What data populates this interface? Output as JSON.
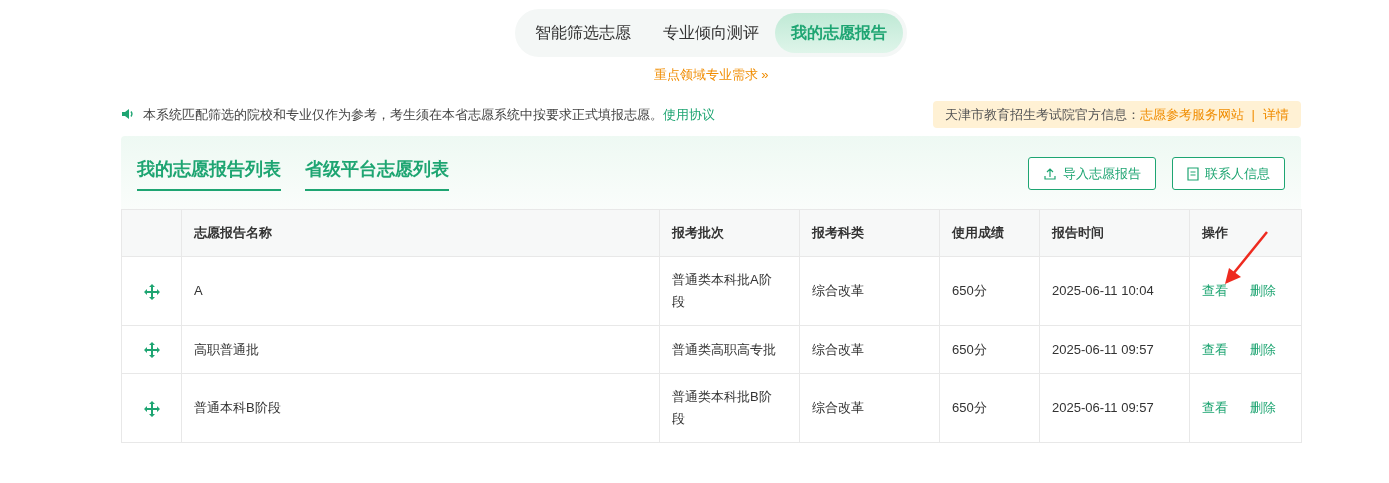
{
  "top_tabs": [
    {
      "label": "智能筛选志愿",
      "selected": false
    },
    {
      "label": "专业倾向测评",
      "selected": false
    },
    {
      "label": "我的志愿报告",
      "selected": true
    }
  ],
  "key_link": {
    "label": "重点领域专业需求",
    "icon": "»"
  },
  "notice": {
    "text": "本系统匹配筛选的院校和专业仅作为参考，考生须在本省志愿系统中按要求正式填报志愿。",
    "link": "使用协议"
  },
  "official_info": {
    "label": "天津市教育招生考试院官方信息：",
    "link": "志愿参考服务网站",
    "separator": "|",
    "detail": "详情"
  },
  "list_tabs": [
    "我的志愿报告列表",
    "省级平台志愿列表"
  ],
  "buttons": [
    {
      "label": "导入志愿报告",
      "kind": "upload"
    },
    {
      "label": "联系人信息",
      "kind": "contact"
    }
  ],
  "table": {
    "columns": [
      "志愿报告名称",
      "报考批次",
      "报考科类",
      "使用成绩",
      "报告时间",
      "操作"
    ],
    "rows": [
      {
        "name": "A",
        "batch": "普通类本科批A阶段",
        "subject": "综合改革",
        "score": "650分",
        "time": "2025-06-11 10:04",
        "actions": [
          "查看",
          "删除"
        ]
      },
      {
        "name": "高职普通批",
        "batch": "普通类高职高专批",
        "subject": "综合改革",
        "score": "650分",
        "time": "2025-06-11 09:57",
        "actions": [
          "查看",
          "删除"
        ]
      },
      {
        "name": "普通本科B阶段",
        "batch": "普通类本科批B阶段",
        "subject": "综合改革",
        "score": "650分",
        "time": "2025-06-11 09:57",
        "actions": [
          "查看",
          "删除"
        ]
      }
    ]
  },
  "annotation": {
    "kind": "arrow"
  }
}
